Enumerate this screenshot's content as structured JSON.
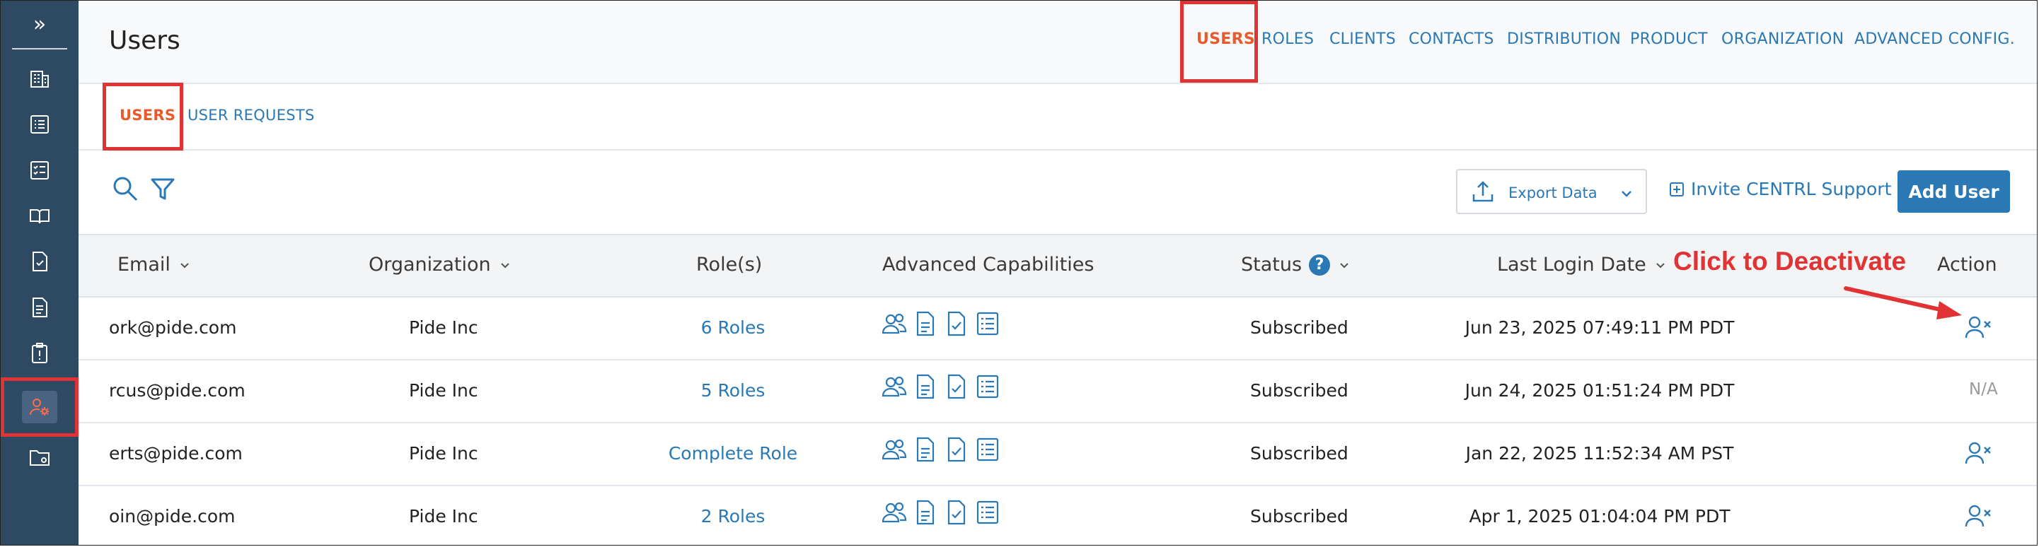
{
  "header": {
    "title": "Users",
    "nav": [
      {
        "label": "USERS",
        "active": true
      },
      {
        "label": "ROLES"
      },
      {
        "label": "CLIENTS"
      },
      {
        "label": "CONTACTS"
      },
      {
        "label": "DISTRIBUTION"
      },
      {
        "label": "PRODUCT"
      },
      {
        "label": "ORGANIZATION"
      },
      {
        "label": "ADVANCED CONFIG."
      }
    ]
  },
  "subtabs": [
    {
      "label": "USERS",
      "active": true
    },
    {
      "label": "USER REQUESTS"
    }
  ],
  "toolbar": {
    "export_label": "Export Data",
    "invite_label": "Invite CENTRL Support",
    "add_user_label": "Add User"
  },
  "table": {
    "columns": {
      "email": "Email",
      "organization": "Organization",
      "roles": "Role(s)",
      "capabilities": "Advanced Capabilities",
      "status": "Status",
      "last_login": "Last Login Date",
      "action": "Action"
    },
    "rows": [
      {
        "email": "ork@pide.com",
        "organization": "Pide Inc",
        "roles": "6 Roles",
        "status": "Subscribed",
        "last_login": "Jun 23, 2025 07:49:11 PM PDT",
        "action": "deactivate"
      },
      {
        "email": "rcus@pide.com",
        "organization": "Pide Inc",
        "roles": "5 Roles",
        "status": "Subscribed",
        "last_login": "Jun 24, 2025 01:51:24 PM PDT",
        "action": "N/A"
      },
      {
        "email": "erts@pide.com",
        "organization": "Pide Inc",
        "roles": "Complete Role",
        "status": "Subscribed",
        "last_login": "Jan 22, 2025 11:52:34 AM PST",
        "action": "deactivate"
      },
      {
        "email": "oin@pide.com",
        "organization": "Pide Inc",
        "roles": "2 Roles",
        "status": "Subscribed",
        "last_login": "Apr 1, 2025 01:04:04 PM PDT",
        "action": "deactivate"
      }
    ]
  },
  "annotation": {
    "text": "Click to Deactivate"
  },
  "colors": {
    "accent": "#2a78b4",
    "active_tab": "#e85a2c",
    "highlight": "#e03434",
    "sidebar": "#2e4a63"
  }
}
